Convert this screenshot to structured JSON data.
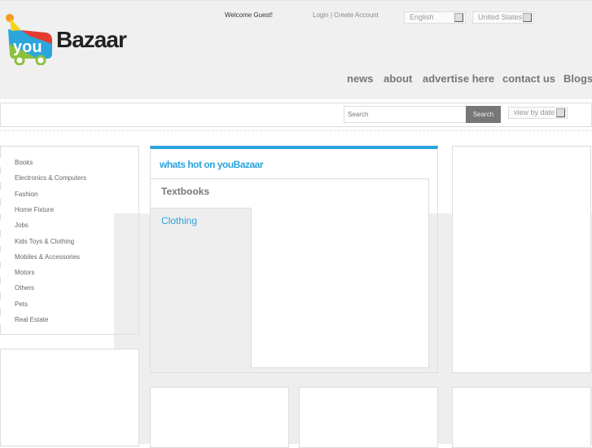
{
  "header": {
    "welcome": "Welcome Guest!",
    "login": "Login",
    "separator": "|",
    "create_account": "Create Account",
    "language": "English",
    "country": "United States",
    "logo_you": "you",
    "logo_bazaar": "Bazaar"
  },
  "nav": [
    "news",
    "about",
    "advertise here",
    "contact us",
    "Blogs"
  ],
  "search": {
    "placeholder": "Search",
    "button": "Search",
    "sort": "view by date"
  },
  "categories": [
    "Books",
    "Electronics & Computers",
    "Fashion",
    "Home Fixture",
    "Jobs",
    "Kids Toys & Clothing",
    "Mobiles & Accessories",
    "Motors",
    "Others",
    "Pets",
    "Real Estate"
  ],
  "hot": {
    "title": "whats hot on youBazaar",
    "tabs": [
      "Textbooks",
      "Clothing"
    ]
  },
  "colors": {
    "accent": "#2ba3dd"
  }
}
